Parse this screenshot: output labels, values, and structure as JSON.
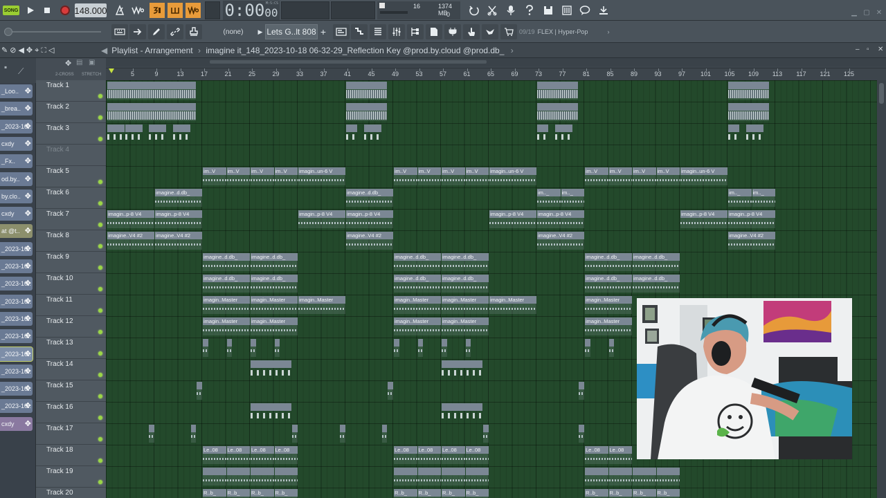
{
  "transport": {
    "song_badge": "SONG",
    "tempo": "148.000",
    "time": "0:00",
    "time_frac": "00",
    "time_unit": "M:S:CS",
    "monitor_cpu": "16",
    "monitor_mem": "1374 MB",
    "monitor_poly": "0"
  },
  "toolbar": {
    "pattern_none": "(none)",
    "pattern_name": "Lets G..lt 808",
    "hint_index": "09/19",
    "hint_text": "FLEX | Hyper-Pop"
  },
  "playlist": {
    "title_prefix": "Playlist - Arrangement",
    "title_sep": "›",
    "title_file": "imagine it_148_2023-10-18 06-32-29_Reflection Key @prod.by.cloud @prod.db_",
    "ruler_left_a": "2-CROSS",
    "ruler_left_b": "STRETCH"
  },
  "bars": [
    5,
    9,
    13,
    17,
    21,
    25,
    29,
    33,
    37,
    41,
    45,
    49,
    53,
    57,
    61,
    65,
    69,
    73,
    77,
    81,
    85,
    89,
    93,
    97,
    101,
    105,
    109,
    113,
    117,
    121,
    125
  ],
  "picker": [
    {
      "label": "_Loo..",
      "style": "normal"
    },
    {
      "label": "_brea..",
      "style": "normal"
    },
    {
      "label": "_2023-10..",
      "style": "normal"
    },
    {
      "label": "cxdy",
      "style": "normal"
    },
    {
      "label": "_Fx..",
      "style": "normal"
    },
    {
      "label": "od.by..",
      "style": "normal"
    },
    {
      "label": "by.clo..",
      "style": "normal"
    },
    {
      "label": "cxdy",
      "style": "normal"
    },
    {
      "label": "at @t..",
      "style": "yellow"
    },
    {
      "label": "_2023-10..",
      "style": "normal"
    },
    {
      "label": "_2023-10..",
      "style": "normal"
    },
    {
      "label": "_2023-10..",
      "style": "normal"
    },
    {
      "label": "_2023-10..",
      "style": "normal"
    },
    {
      "label": "_2023-10..",
      "style": "normal"
    },
    {
      "label": "_2023-10..",
      "style": "normal"
    },
    {
      "label": "_2023-10..",
      "style": "sel"
    },
    {
      "label": "_2023-10..",
      "style": "normal"
    },
    {
      "label": "_2023-10..",
      "style": "normal"
    },
    {
      "label": "_2023-10..",
      "style": "normal"
    },
    {
      "label": "cxdy",
      "style": "purple"
    }
  ],
  "tracks": [
    {
      "name": "Track 1",
      "active": true
    },
    {
      "name": "Track 2",
      "active": true
    },
    {
      "name": "Track 3",
      "active": true
    },
    {
      "name": "Track 4",
      "active": false
    },
    {
      "name": "Track 5",
      "active": true
    },
    {
      "name": "Track 6",
      "active": true
    },
    {
      "name": "Track 7",
      "active": true
    },
    {
      "name": "Track 8",
      "active": true
    },
    {
      "name": "Track 9",
      "active": true
    },
    {
      "name": "Track 10",
      "active": true
    },
    {
      "name": "Track 11",
      "active": true
    },
    {
      "name": "Track 12",
      "active": true
    },
    {
      "name": "Track 13",
      "active": true
    },
    {
      "name": "Track 14",
      "active": true
    },
    {
      "name": "Track 15",
      "active": true
    },
    {
      "name": "Track 16",
      "active": true
    },
    {
      "name": "Track 17",
      "active": true
    },
    {
      "name": "Track 18",
      "active": true
    },
    {
      "name": "Track 19",
      "active": true
    },
    {
      "name": "Track 20",
      "active": true
    }
  ],
  "clip_labels": {
    "im_v": "im..V",
    "un6": "imagin..un-6 V",
    "ddb": "imagine..d.db_",
    "im_short": "im.._",
    "p8v4": "imagin..p-8 V4",
    "v4_2": "imagine..V4 #2",
    "master": "imagin..Master",
    "le08": "Le..08",
    "rb": "R..b_"
  },
  "clips": [
    {
      "track": 1,
      "start": 1,
      "len": 15,
      "label": "",
      "kind": "dense"
    },
    {
      "track": 1,
      "start": 41,
      "len": 7,
      "label": "",
      "kind": "dense"
    },
    {
      "track": 1,
      "start": 73,
      "len": 7,
      "label": "",
      "kind": "dense"
    },
    {
      "track": 1,
      "start": 105,
      "len": 7,
      "label": "",
      "kind": "dense"
    },
    {
      "track": 2,
      "start": 1,
      "len": 15,
      "label": "",
      "kind": "dense"
    },
    {
      "track": 2,
      "start": 41,
      "len": 7,
      "label": "",
      "kind": "dense"
    },
    {
      "track": 2,
      "start": 73,
      "len": 7,
      "label": "",
      "kind": "dense"
    },
    {
      "track": 2,
      "start": 105,
      "len": 7,
      "label": "",
      "kind": "dense"
    },
    {
      "track": 3,
      "start": 1,
      "len": 3,
      "label": "",
      "kind": "hits"
    },
    {
      "track": 3,
      "start": 4,
      "len": 3,
      "label": "",
      "kind": "hits"
    },
    {
      "track": 3,
      "start": 8,
      "len": 3,
      "label": "",
      "kind": "hits"
    },
    {
      "track": 3,
      "start": 12,
      "len": 3,
      "label": "",
      "kind": "hits"
    },
    {
      "track": 3,
      "start": 41,
      "len": 2,
      "label": "",
      "kind": "hits"
    },
    {
      "track": 3,
      "start": 44,
      "len": 3,
      "label": "",
      "kind": "hits"
    },
    {
      "track": 3,
      "start": 73,
      "len": 2,
      "label": "",
      "kind": "hits"
    },
    {
      "track": 3,
      "start": 76,
      "len": 3,
      "label": "",
      "kind": "hits"
    },
    {
      "track": 3,
      "start": 105,
      "len": 2,
      "label": "",
      "kind": "hits"
    },
    {
      "track": 3,
      "start": 108,
      "len": 3,
      "label": "",
      "kind": "hits"
    },
    {
      "track": 5,
      "start": 17,
      "len": 4,
      "label": "im_v",
      "kind": "wave"
    },
    {
      "track": 5,
      "start": 21,
      "len": 4,
      "label": "im_v",
      "kind": "wave"
    },
    {
      "track": 5,
      "start": 25,
      "len": 4,
      "label": "im_v",
      "kind": "wave"
    },
    {
      "track": 5,
      "start": 29,
      "len": 4,
      "label": "im_v",
      "kind": "wave"
    },
    {
      "track": 5,
      "start": 33,
      "len": 8,
      "label": "un6",
      "kind": "wave"
    },
    {
      "track": 5,
      "start": 49,
      "len": 4,
      "label": "im_v",
      "kind": "wave"
    },
    {
      "track": 5,
      "start": 53,
      "len": 4,
      "label": "im_v",
      "kind": "wave"
    },
    {
      "track": 5,
      "start": 57,
      "len": 4,
      "label": "im_v",
      "kind": "wave"
    },
    {
      "track": 5,
      "start": 61,
      "len": 4,
      "label": "im_v",
      "kind": "wave"
    },
    {
      "track": 5,
      "start": 65,
      "len": 8,
      "label": "un6",
      "kind": "wave"
    },
    {
      "track": 5,
      "start": 81,
      "len": 4,
      "label": "im_v",
      "kind": "wave"
    },
    {
      "track": 5,
      "start": 85,
      "len": 4,
      "label": "im_v",
      "kind": "wave"
    },
    {
      "track": 5,
      "start": 89,
      "len": 4,
      "label": "im_v",
      "kind": "wave"
    },
    {
      "track": 5,
      "start": 93,
      "len": 4,
      "label": "im_v",
      "kind": "wave"
    },
    {
      "track": 5,
      "start": 97,
      "len": 8,
      "label": "un6",
      "kind": "wave"
    },
    {
      "track": 6,
      "start": 9,
      "len": 8,
      "label": "ddb",
      "kind": "wave"
    },
    {
      "track": 6,
      "start": 41,
      "len": 8,
      "label": "ddb",
      "kind": "wave"
    },
    {
      "track": 6,
      "start": 73,
      "len": 4,
      "label": "im_short",
      "kind": "wave"
    },
    {
      "track": 6,
      "start": 77,
      "len": 4,
      "label": "im_short",
      "kind": "wave"
    },
    {
      "track": 6,
      "start": 105,
      "len": 4,
      "label": "im_short",
      "kind": "wave"
    },
    {
      "track": 6,
      "start": 109,
      "len": 4,
      "label": "im_short",
      "kind": "wave"
    },
    {
      "track": 7,
      "start": 1,
      "len": 8,
      "label": "p8v4",
      "kind": "wave"
    },
    {
      "track": 7,
      "start": 9,
      "len": 8,
      "label": "p8v4",
      "kind": "wave"
    },
    {
      "track": 7,
      "start": 33,
      "len": 8,
      "label": "p8v4",
      "kind": "wave"
    },
    {
      "track": 7,
      "start": 41,
      "len": 8,
      "label": "p8v4",
      "kind": "wave"
    },
    {
      "track": 7,
      "start": 65,
      "len": 8,
      "label": "p8v4",
      "kind": "wave"
    },
    {
      "track": 7,
      "start": 73,
      "len": 8,
      "label": "p8v4",
      "kind": "wave"
    },
    {
      "track": 7,
      "start": 97,
      "len": 8,
      "label": "p8v4",
      "kind": "wave"
    },
    {
      "track": 7,
      "start": 105,
      "len": 8,
      "label": "p8v4",
      "kind": "wave"
    },
    {
      "track": 8,
      "start": 1,
      "len": 8,
      "label": "v4_2",
      "kind": "wave"
    },
    {
      "track": 8,
      "start": 9,
      "len": 8,
      "label": "v4_2",
      "kind": "wave"
    },
    {
      "track": 8,
      "start": 41,
      "len": 8,
      "label": "v4_2",
      "kind": "wave"
    },
    {
      "track": 8,
      "start": 73,
      "len": 8,
      "label": "v4_2",
      "kind": "wave"
    },
    {
      "track": 8,
      "start": 105,
      "len": 8,
      "label": "v4_2",
      "kind": "wave"
    },
    {
      "track": 9,
      "start": 17,
      "len": 8,
      "label": "ddb",
      "kind": "wave"
    },
    {
      "track": 9,
      "start": 25,
      "len": 8,
      "label": "ddb",
      "kind": "wave"
    },
    {
      "track": 9,
      "start": 49,
      "len": 8,
      "label": "ddb",
      "kind": "wave"
    },
    {
      "track": 9,
      "start": 57,
      "len": 8,
      "label": "ddb",
      "kind": "wave"
    },
    {
      "track": 9,
      "start": 81,
      "len": 8,
      "label": "ddb",
      "kind": "wave"
    },
    {
      "track": 9,
      "start": 89,
      "len": 8,
      "label": "ddb",
      "kind": "wave"
    },
    {
      "track": 10,
      "start": 17,
      "len": 8,
      "label": "ddb",
      "kind": "wave"
    },
    {
      "track": 10,
      "start": 25,
      "len": 8,
      "label": "ddb",
      "kind": "wave"
    },
    {
      "track": 10,
      "start": 49,
      "len": 8,
      "label": "ddb",
      "kind": "wave"
    },
    {
      "track": 10,
      "start": 57,
      "len": 8,
      "label": "ddb",
      "kind": "wave"
    },
    {
      "track": 10,
      "start": 81,
      "len": 8,
      "label": "ddb",
      "kind": "wave"
    },
    {
      "track": 10,
      "start": 89,
      "len": 8,
      "label": "ddb",
      "kind": "wave"
    },
    {
      "track": 11,
      "start": 17,
      "len": 8,
      "label": "master",
      "kind": "wave"
    },
    {
      "track": 11,
      "start": 25,
      "len": 8,
      "label": "master",
      "kind": "wave"
    },
    {
      "track": 11,
      "start": 33,
      "len": 8,
      "label": "master",
      "kind": "wave"
    },
    {
      "track": 11,
      "start": 49,
      "len": 8,
      "label": "master",
      "kind": "wave"
    },
    {
      "track": 11,
      "start": 57,
      "len": 8,
      "label": "master",
      "kind": "wave"
    },
    {
      "track": 11,
      "start": 65,
      "len": 8,
      "label": "master",
      "kind": "wave"
    },
    {
      "track": 11,
      "start": 81,
      "len": 8,
      "label": "master",
      "kind": "wave"
    },
    {
      "track": 12,
      "start": 17,
      "len": 8,
      "label": "master",
      "kind": "wave"
    },
    {
      "track": 12,
      "start": 25,
      "len": 8,
      "label": "master",
      "kind": "wave"
    },
    {
      "track": 12,
      "start": 49,
      "len": 8,
      "label": "master",
      "kind": "wave"
    },
    {
      "track": 12,
      "start": 57,
      "len": 8,
      "label": "master",
      "kind": "wave"
    },
    {
      "track": 12,
      "start": 81,
      "len": 8,
      "label": "master",
      "kind": "wave"
    },
    {
      "track": 13,
      "start": 17,
      "len": 1,
      "label": "",
      "kind": "slim"
    },
    {
      "track": 13,
      "start": 21,
      "len": 1,
      "label": "",
      "kind": "slim"
    },
    {
      "track": 13,
      "start": 25,
      "len": 1,
      "label": "",
      "kind": "slim"
    },
    {
      "track": 13,
      "start": 29,
      "len": 1,
      "label": "",
      "kind": "slim"
    },
    {
      "track": 13,
      "start": 49,
      "len": 1,
      "label": "",
      "kind": "slim"
    },
    {
      "track": 13,
      "start": 53,
      "len": 1,
      "label": "",
      "kind": "slim"
    },
    {
      "track": 13,
      "start": 57,
      "len": 1,
      "label": "",
      "kind": "slim"
    },
    {
      "track": 13,
      "start": 61,
      "len": 1,
      "label": "",
      "kind": "slim"
    },
    {
      "track": 13,
      "start": 81,
      "len": 1,
      "label": "",
      "kind": "slim"
    },
    {
      "track": 13,
      "start": 85,
      "len": 1,
      "label": "",
      "kind": "slim"
    },
    {
      "track": 14,
      "start": 25,
      "len": 7,
      "label": "",
      "kind": "hits"
    },
    {
      "track": 14,
      "start": 57,
      "len": 7,
      "label": "",
      "kind": "hits"
    },
    {
      "track": 15,
      "start": 16,
      "len": 1,
      "label": "",
      "kind": "slim"
    },
    {
      "track": 15,
      "start": 48,
      "len": 1,
      "label": "",
      "kind": "slim"
    },
    {
      "track": 15,
      "start": 80,
      "len": 1,
      "label": "",
      "kind": "slim"
    },
    {
      "track": 16,
      "start": 25,
      "len": 7,
      "label": "",
      "kind": "hits"
    },
    {
      "track": 16,
      "start": 57,
      "len": 7,
      "label": "",
      "kind": "hits"
    },
    {
      "track": 17,
      "start": 8,
      "len": 1,
      "label": "",
      "kind": "slim"
    },
    {
      "track": 17,
      "start": 15,
      "len": 1,
      "label": "",
      "kind": "slim"
    },
    {
      "track": 17,
      "start": 32,
      "len": 1,
      "label": "",
      "kind": "slim"
    },
    {
      "track": 17,
      "start": 40,
      "len": 1,
      "label": "",
      "kind": "slim"
    },
    {
      "track": 17,
      "start": 47,
      "len": 1,
      "label": "",
      "kind": "slim"
    },
    {
      "track": 17,
      "start": 64,
      "len": 1,
      "label": "",
      "kind": "slim"
    },
    {
      "track": 17,
      "start": 80,
      "len": 1,
      "label": "",
      "kind": "slim"
    },
    {
      "track": 18,
      "start": 17,
      "len": 4,
      "label": "le08",
      "kind": "wave"
    },
    {
      "track": 18,
      "start": 21,
      "len": 4,
      "label": "le08",
      "kind": "wave"
    },
    {
      "track": 18,
      "start": 25,
      "len": 4,
      "label": "le08",
      "kind": "wave"
    },
    {
      "track": 18,
      "start": 29,
      "len": 4,
      "label": "le08",
      "kind": "wave"
    },
    {
      "track": 18,
      "start": 49,
      "len": 4,
      "label": "le08",
      "kind": "wave"
    },
    {
      "track": 18,
      "start": 53,
      "len": 4,
      "label": "le08",
      "kind": "wave"
    },
    {
      "track": 18,
      "start": 57,
      "len": 4,
      "label": "le08",
      "kind": "wave"
    },
    {
      "track": 18,
      "start": 61,
      "len": 4,
      "label": "le08",
      "kind": "wave"
    },
    {
      "track": 18,
      "start": 81,
      "len": 4,
      "label": "le08",
      "kind": "wave"
    },
    {
      "track": 18,
      "start": 85,
      "len": 4,
      "label": "le08",
      "kind": "wave"
    },
    {
      "track": 19,
      "start": 17,
      "len": 4,
      "label": "",
      "kind": "wave"
    },
    {
      "track": 19,
      "start": 21,
      "len": 4,
      "label": "",
      "kind": "wave"
    },
    {
      "track": 19,
      "start": 25,
      "len": 4,
      "label": "",
      "kind": "wave"
    },
    {
      "track": 19,
      "start": 29,
      "len": 4,
      "label": "",
      "kind": "wave"
    },
    {
      "track": 19,
      "start": 49,
      "len": 4,
      "label": "",
      "kind": "wave"
    },
    {
      "track": 19,
      "start": 53,
      "len": 4,
      "label": "",
      "kind": "wave"
    },
    {
      "track": 19,
      "start": 57,
      "len": 4,
      "label": "",
      "kind": "wave"
    },
    {
      "track": 19,
      "start": 61,
      "len": 4,
      "label": "",
      "kind": "wave"
    },
    {
      "track": 19,
      "start": 81,
      "len": 4,
      "label": "",
      "kind": "wave"
    },
    {
      "track": 19,
      "start": 85,
      "len": 4,
      "label": "",
      "kind": "wave"
    },
    {
      "track": 19,
      "start": 89,
      "len": 4,
      "label": "",
      "kind": "wave"
    },
    {
      "track": 19,
      "start": 93,
      "len": 4,
      "label": "",
      "kind": "wave"
    },
    {
      "track": 20,
      "start": 17,
      "len": 4,
      "label": "rb",
      "kind": "wave"
    },
    {
      "track": 20,
      "start": 21,
      "len": 4,
      "label": "rb",
      "kind": "wave"
    },
    {
      "track": 20,
      "start": 25,
      "len": 4,
      "label": "rb",
      "kind": "wave"
    },
    {
      "track": 20,
      "start": 29,
      "len": 4,
      "label": "rb",
      "kind": "wave"
    },
    {
      "track": 20,
      "start": 49,
      "len": 4,
      "label": "rb",
      "kind": "wave"
    },
    {
      "track": 20,
      "start": 53,
      "len": 4,
      "label": "rb",
      "kind": "wave"
    },
    {
      "track": 20,
      "start": 57,
      "len": 4,
      "label": "rb",
      "kind": "wave"
    },
    {
      "track": 20,
      "start": 61,
      "len": 4,
      "label": "rb",
      "kind": "wave"
    },
    {
      "track": 20,
      "start": 81,
      "len": 4,
      "label": "rb",
      "kind": "wave"
    },
    {
      "track": 20,
      "start": 85,
      "len": 4,
      "label": "rb",
      "kind": "wave"
    },
    {
      "track": 20,
      "start": 89,
      "len": 4,
      "label": "rb",
      "kind": "wave"
    },
    {
      "track": 20,
      "start": 93,
      "len": 4,
      "label": "rb",
      "kind": "wave"
    }
  ],
  "colors": {
    "grid_bg": "#23492b",
    "clip_header": "#7b8794",
    "accent_green": "#9bd646",
    "record_red": "#d83b3b",
    "orange_btn": "#e89b3a"
  },
  "icons": {
    "play": "play-icon",
    "stop": "stop-icon",
    "record": "record-icon",
    "metronome": "metronome-icon",
    "minimize": "minimize-icon",
    "close": "close-icon"
  }
}
